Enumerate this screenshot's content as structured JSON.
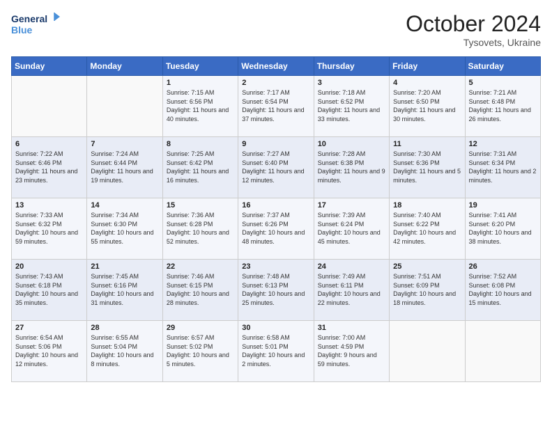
{
  "header": {
    "logo_line1": "General",
    "logo_line2": "Blue",
    "month": "October 2024",
    "location": "Tysovets, Ukraine"
  },
  "days_of_week": [
    "Sunday",
    "Monday",
    "Tuesday",
    "Wednesday",
    "Thursday",
    "Friday",
    "Saturday"
  ],
  "weeks": [
    [
      {
        "day": "",
        "sunrise": "",
        "sunset": "",
        "daylight": ""
      },
      {
        "day": "",
        "sunrise": "",
        "sunset": "",
        "daylight": ""
      },
      {
        "day": "1",
        "sunrise": "Sunrise: 7:15 AM",
        "sunset": "Sunset: 6:56 PM",
        "daylight": "Daylight: 11 hours and 40 minutes."
      },
      {
        "day": "2",
        "sunrise": "Sunrise: 7:17 AM",
        "sunset": "Sunset: 6:54 PM",
        "daylight": "Daylight: 11 hours and 37 minutes."
      },
      {
        "day": "3",
        "sunrise": "Sunrise: 7:18 AM",
        "sunset": "Sunset: 6:52 PM",
        "daylight": "Daylight: 11 hours and 33 minutes."
      },
      {
        "day": "4",
        "sunrise": "Sunrise: 7:20 AM",
        "sunset": "Sunset: 6:50 PM",
        "daylight": "Daylight: 11 hours and 30 minutes."
      },
      {
        "day": "5",
        "sunrise": "Sunrise: 7:21 AM",
        "sunset": "Sunset: 6:48 PM",
        "daylight": "Daylight: 11 hours and 26 minutes."
      }
    ],
    [
      {
        "day": "6",
        "sunrise": "Sunrise: 7:22 AM",
        "sunset": "Sunset: 6:46 PM",
        "daylight": "Daylight: 11 hours and 23 minutes."
      },
      {
        "day": "7",
        "sunrise": "Sunrise: 7:24 AM",
        "sunset": "Sunset: 6:44 PM",
        "daylight": "Daylight: 11 hours and 19 minutes."
      },
      {
        "day": "8",
        "sunrise": "Sunrise: 7:25 AM",
        "sunset": "Sunset: 6:42 PM",
        "daylight": "Daylight: 11 hours and 16 minutes."
      },
      {
        "day": "9",
        "sunrise": "Sunrise: 7:27 AM",
        "sunset": "Sunset: 6:40 PM",
        "daylight": "Daylight: 11 hours and 12 minutes."
      },
      {
        "day": "10",
        "sunrise": "Sunrise: 7:28 AM",
        "sunset": "Sunset: 6:38 PM",
        "daylight": "Daylight: 11 hours and 9 minutes."
      },
      {
        "day": "11",
        "sunrise": "Sunrise: 7:30 AM",
        "sunset": "Sunset: 6:36 PM",
        "daylight": "Daylight: 11 hours and 5 minutes."
      },
      {
        "day": "12",
        "sunrise": "Sunrise: 7:31 AM",
        "sunset": "Sunset: 6:34 PM",
        "daylight": "Daylight: 11 hours and 2 minutes."
      }
    ],
    [
      {
        "day": "13",
        "sunrise": "Sunrise: 7:33 AM",
        "sunset": "Sunset: 6:32 PM",
        "daylight": "Daylight: 10 hours and 59 minutes."
      },
      {
        "day": "14",
        "sunrise": "Sunrise: 7:34 AM",
        "sunset": "Sunset: 6:30 PM",
        "daylight": "Daylight: 10 hours and 55 minutes."
      },
      {
        "day": "15",
        "sunrise": "Sunrise: 7:36 AM",
        "sunset": "Sunset: 6:28 PM",
        "daylight": "Daylight: 10 hours and 52 minutes."
      },
      {
        "day": "16",
        "sunrise": "Sunrise: 7:37 AM",
        "sunset": "Sunset: 6:26 PM",
        "daylight": "Daylight: 10 hours and 48 minutes."
      },
      {
        "day": "17",
        "sunrise": "Sunrise: 7:39 AM",
        "sunset": "Sunset: 6:24 PM",
        "daylight": "Daylight: 10 hours and 45 minutes."
      },
      {
        "day": "18",
        "sunrise": "Sunrise: 7:40 AM",
        "sunset": "Sunset: 6:22 PM",
        "daylight": "Daylight: 10 hours and 42 minutes."
      },
      {
        "day": "19",
        "sunrise": "Sunrise: 7:41 AM",
        "sunset": "Sunset: 6:20 PM",
        "daylight": "Daylight: 10 hours and 38 minutes."
      }
    ],
    [
      {
        "day": "20",
        "sunrise": "Sunrise: 7:43 AM",
        "sunset": "Sunset: 6:18 PM",
        "daylight": "Daylight: 10 hours and 35 minutes."
      },
      {
        "day": "21",
        "sunrise": "Sunrise: 7:45 AM",
        "sunset": "Sunset: 6:16 PM",
        "daylight": "Daylight: 10 hours and 31 minutes."
      },
      {
        "day": "22",
        "sunrise": "Sunrise: 7:46 AM",
        "sunset": "Sunset: 6:15 PM",
        "daylight": "Daylight: 10 hours and 28 minutes."
      },
      {
        "day": "23",
        "sunrise": "Sunrise: 7:48 AM",
        "sunset": "Sunset: 6:13 PM",
        "daylight": "Daylight: 10 hours and 25 minutes."
      },
      {
        "day": "24",
        "sunrise": "Sunrise: 7:49 AM",
        "sunset": "Sunset: 6:11 PM",
        "daylight": "Daylight: 10 hours and 22 minutes."
      },
      {
        "day": "25",
        "sunrise": "Sunrise: 7:51 AM",
        "sunset": "Sunset: 6:09 PM",
        "daylight": "Daylight: 10 hours and 18 minutes."
      },
      {
        "day": "26",
        "sunrise": "Sunrise: 7:52 AM",
        "sunset": "Sunset: 6:08 PM",
        "daylight": "Daylight: 10 hours and 15 minutes."
      }
    ],
    [
      {
        "day": "27",
        "sunrise": "Sunrise: 6:54 AM",
        "sunset": "Sunset: 5:06 PM",
        "daylight": "Daylight: 10 hours and 12 minutes."
      },
      {
        "day": "28",
        "sunrise": "Sunrise: 6:55 AM",
        "sunset": "Sunset: 5:04 PM",
        "daylight": "Daylight: 10 hours and 8 minutes."
      },
      {
        "day": "29",
        "sunrise": "Sunrise: 6:57 AM",
        "sunset": "Sunset: 5:02 PM",
        "daylight": "Daylight: 10 hours and 5 minutes."
      },
      {
        "day": "30",
        "sunrise": "Sunrise: 6:58 AM",
        "sunset": "Sunset: 5:01 PM",
        "daylight": "Daylight: 10 hours and 2 minutes."
      },
      {
        "day": "31",
        "sunrise": "Sunrise: 7:00 AM",
        "sunset": "Sunset: 4:59 PM",
        "daylight": "Daylight: 9 hours and 59 minutes."
      },
      {
        "day": "",
        "sunrise": "",
        "sunset": "",
        "daylight": ""
      },
      {
        "day": "",
        "sunrise": "",
        "sunset": "",
        "daylight": ""
      }
    ]
  ]
}
